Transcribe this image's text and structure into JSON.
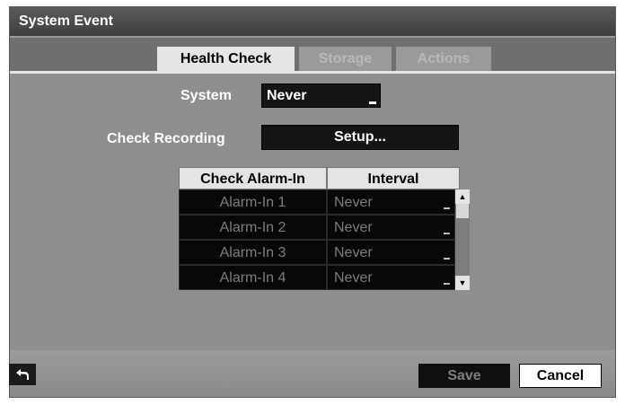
{
  "window": {
    "title": "System Event"
  },
  "tabs": [
    {
      "label": "Health Check",
      "active": true
    },
    {
      "label": "Storage",
      "active": false
    },
    {
      "label": "Actions",
      "active": false
    }
  ],
  "system": {
    "label": "System",
    "value": "Never"
  },
  "check_recording": {
    "label": "Check Recording",
    "button": "Setup..."
  },
  "alarm_table": {
    "headers": [
      "Check Alarm-In",
      "Interval"
    ],
    "rows": [
      {
        "name": "Alarm-In 1",
        "interval": "Never"
      },
      {
        "name": "Alarm-In 2",
        "interval": "Never"
      },
      {
        "name": "Alarm-In 3",
        "interval": "Never"
      },
      {
        "name": "Alarm-In 4",
        "interval": "Never"
      }
    ]
  },
  "footer": {
    "save": "Save",
    "cancel": "Cancel"
  }
}
